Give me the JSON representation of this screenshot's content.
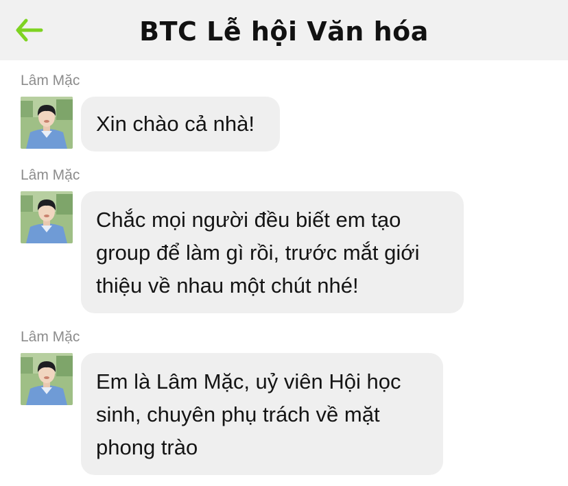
{
  "header": {
    "title": "BTC Lễ hội Văn hóa",
    "back_icon": "arrow-left-icon",
    "accent_color": "#7ed321"
  },
  "messages": [
    {
      "sender": "Lâm Mặc",
      "lines": [
        "Xin chào cả nhà!"
      ]
    },
    {
      "sender": "Lâm Mặc",
      "lines": [
        "Chắc mọi người đều biết em tạo",
        "group để làm gì rồi, trước mắt giới",
        "thiệu về nhau một chút nhé!"
      ]
    },
    {
      "sender": "Lâm Mặc",
      "lines": [
        "Em là Lâm Mặc, uỷ viên Hội học",
        "sinh, chuyên phụ trách về mặt",
        "phong trào"
      ]
    }
  ]
}
